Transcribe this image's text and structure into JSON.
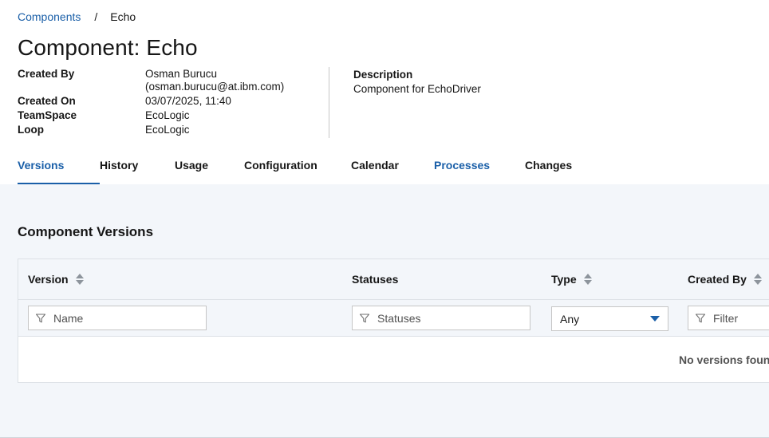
{
  "breadcrumb": {
    "parent": "Components",
    "separator": "/",
    "current": "Echo"
  },
  "title": "Component: Echo",
  "details": {
    "created_by_label": "Created By",
    "created_by_name": "Osman Burucu",
    "created_by_email": "(osman.burucu@at.ibm.com)",
    "created_on_label": "Created On",
    "created_on_value": "03/07/2025, 11:40",
    "teamspace_label": "TeamSpace",
    "teamspace_value": "EcoLogic",
    "loop_label": "Loop",
    "loop_value": "EcoLogic",
    "description_label": "Description",
    "description_value": "Component for EchoDriver"
  },
  "tabs": [
    {
      "label": "Versions",
      "state": "active"
    },
    {
      "label": "History",
      "state": "normal"
    },
    {
      "label": "Usage",
      "state": "normal"
    },
    {
      "label": "Configuration",
      "state": "normal"
    },
    {
      "label": "Calendar",
      "state": "normal"
    },
    {
      "label": "Processes",
      "state": "link"
    },
    {
      "label": "Changes",
      "state": "normal"
    }
  ],
  "versions": {
    "section_title": "Component Versions",
    "columns": {
      "version": "Version",
      "statuses": "Statuses",
      "type": "Type",
      "created_by": "Created By"
    },
    "filters": {
      "name_placeholder": "Name",
      "statuses_placeholder": "Statuses",
      "type_selected": "Any",
      "created_by_placeholder": "Filter"
    },
    "empty_message": "No versions found"
  },
  "colors": {
    "accent": "#1a5fa8",
    "panel_bg": "#f3f6fa",
    "text": "#161616"
  },
  "icons": {
    "sort": "sort-icon",
    "filter": "funnel-icon",
    "dropdown": "caret-down-icon"
  }
}
